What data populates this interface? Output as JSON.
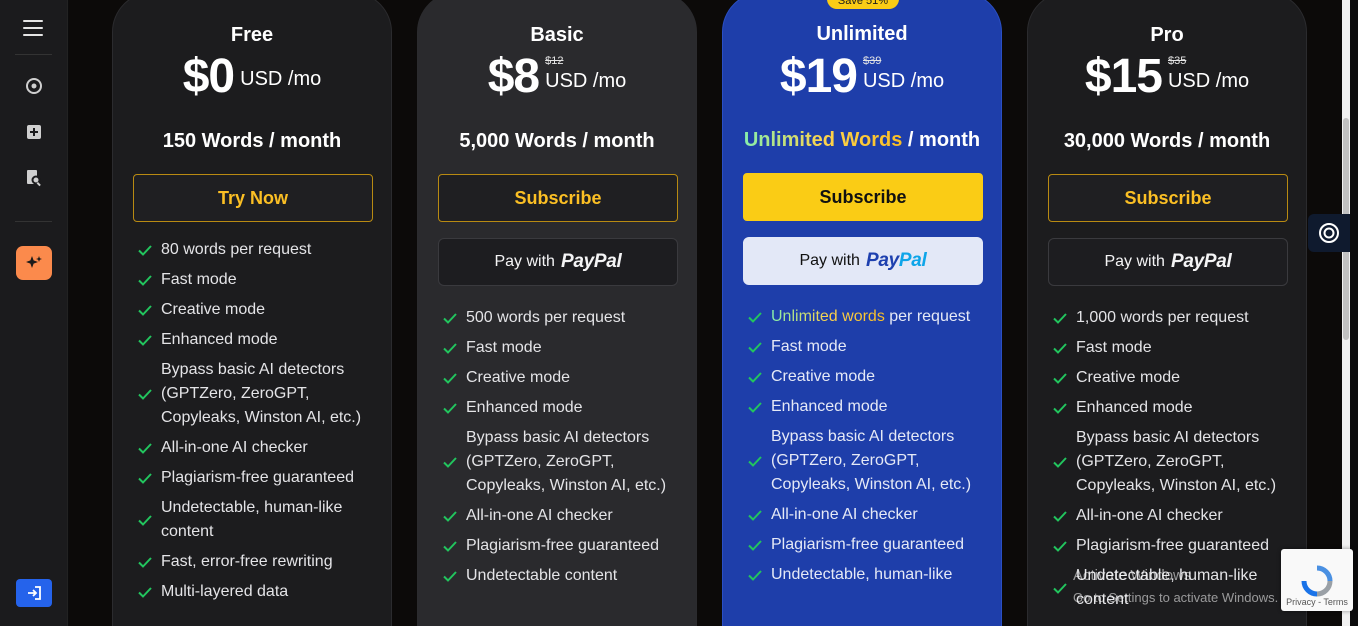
{
  "rail": {
    "icons": [
      "menu-icon",
      "history-icon",
      "add-icon",
      "document-search-icon",
      "sparkle-icon",
      "login-icon"
    ]
  },
  "colors": {
    "accent_yellow": "#facc15",
    "accent_orange": "#fb8a4c",
    "brand_blue": "#1e3eaa",
    "check_green": "#22c55e"
  },
  "plans": [
    {
      "name": "Free",
      "price": "$0",
      "old_price": "",
      "unit": "USD /mo",
      "words_a": "150 Words",
      "words_b": " / month",
      "cta": "Try Now",
      "features": [
        "80 words per request",
        "Fast mode",
        "Creative mode",
        "Enhanced mode",
        "Bypass basic AI detectors (GPTZero, ZeroGPT, Copyleaks, Winston AI, etc.)",
        "All-in-one AI checker",
        "Plagiarism-free guaranteed",
        "Undetectable, human-like content",
        "Fast, error-free rewriting",
        "Multi-layered data"
      ]
    },
    {
      "name": "Basic",
      "price": "$8",
      "old_price": "$12",
      "unit": "USD /mo",
      "words_a": "5,000 Words",
      "words_b": " / month",
      "cta": "Subscribe",
      "paypal_prefix": "Pay with",
      "paypal_logo_a": "Pay",
      "paypal_logo_b": "Pal",
      "features": [
        "500 words per request",
        "Fast mode",
        "Creative mode",
        "Enhanced mode",
        "Bypass basic AI detectors (GPTZero, ZeroGPT, Copyleaks, Winston AI, etc.)",
        "All-in-one AI checker",
        "Plagiarism-free guaranteed",
        "Undetectable content"
      ]
    },
    {
      "name": "Unlimited",
      "badge": "Save 51%",
      "price": "$19",
      "old_price": "$39",
      "unit": "USD /mo",
      "words_a": "Unlimited Words",
      "words_b": " / month",
      "cta": "Subscribe",
      "paypal_prefix": "Pay with",
      "paypal_logo_a": "Pay",
      "paypal_logo_b": "Pal",
      "feature_first_highlight": "Unlimited words",
      "feature_first_rest": " per request",
      "features": [
        "Fast mode",
        "Creative mode",
        "Enhanced mode",
        "Bypass basic AI detectors (GPTZero, ZeroGPT, Copyleaks, Winston AI, etc.)",
        "All-in-one AI checker",
        "Plagiarism-free guaranteed",
        "Undetectable, human-like"
      ]
    },
    {
      "name": "Pro",
      "price": "$15",
      "old_price": "$35",
      "unit": "USD /mo",
      "words_a": "30,000 Words",
      "words_b": " / month",
      "cta": "Subscribe",
      "paypal_prefix": "Pay with",
      "paypal_logo_a": "Pay",
      "paypal_logo_b": "Pal",
      "features": [
        "1,000 words per request",
        "Fast mode",
        "Creative mode",
        "Enhanced mode",
        "Bypass basic AI detectors (GPTZero, ZeroGPT, Copyleaks, Winston AI, etc.)",
        "All-in-one AI checker",
        "Plagiarism-free guaranteed",
        "Undetectable, human-like content"
      ]
    }
  ],
  "overlay": {
    "watermark_title": "Activate Windows",
    "watermark_sub": "Go to Settings to activate Windows.",
    "recaptcha_links": "Privacy - Terms"
  }
}
